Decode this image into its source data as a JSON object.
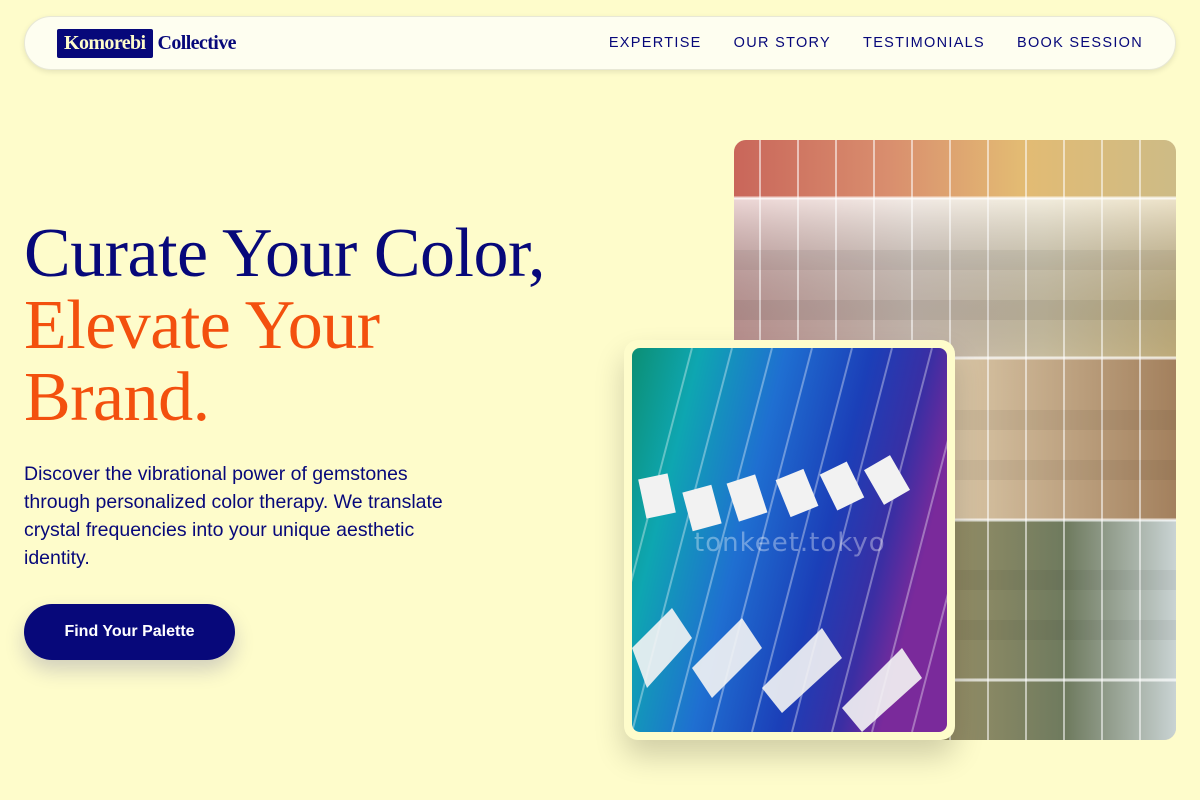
{
  "nav": {
    "logo_box": "Komorebi",
    "logo_text": "Collective",
    "links": [
      "EXPERTISE",
      "OUR STORY",
      "TESTIMONIALS",
      "BOOK SESSION"
    ]
  },
  "hero": {
    "title_line1": "Curate Your Color,",
    "title_line2": "Elevate Your",
    "title_line3": "Brand.",
    "subtitle": "Discover the vibrational power of gemstones through personalized color therapy. We translate crystal frequencies into your unique aesthetic identity.",
    "cta_label": "Find Your Palette"
  },
  "images": {
    "back_image": "paint-chip-swatch-rack-photo",
    "front_image": "color-fan-deck-photo",
    "watermark": "tonkeet.tokyo"
  },
  "colors": {
    "background": "#fefccb",
    "navy": "#07087a",
    "accent": "#f3500e"
  }
}
